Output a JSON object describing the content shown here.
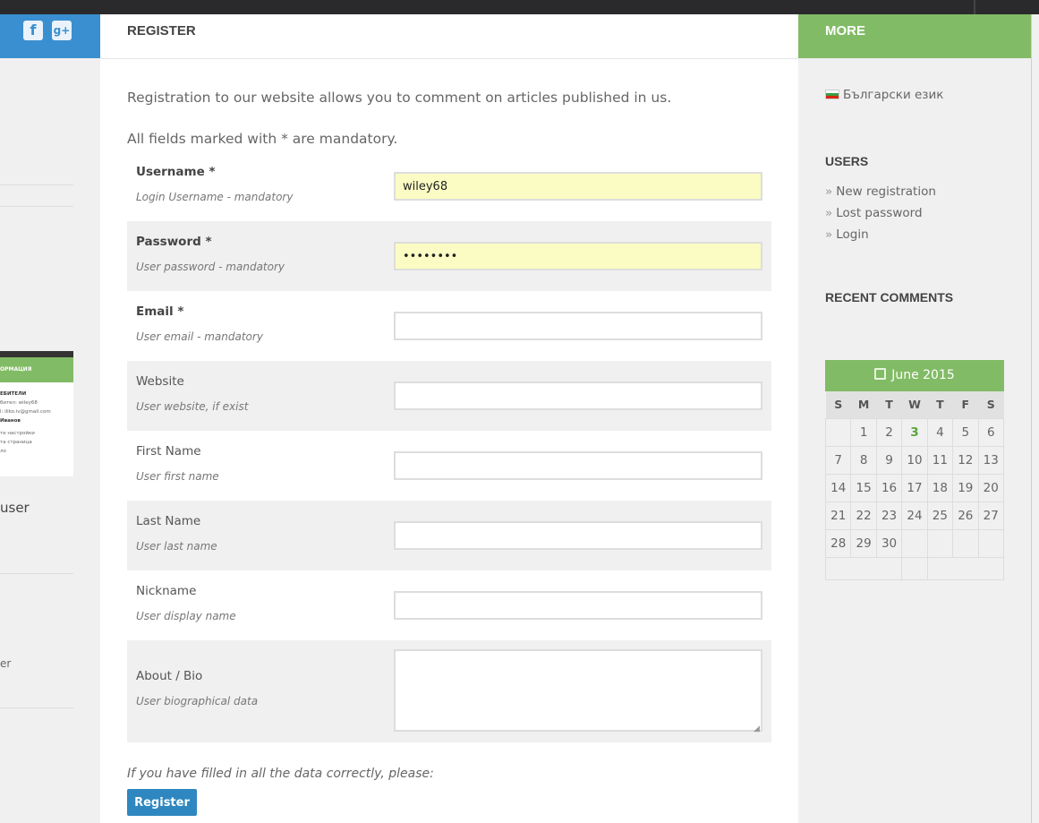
{
  "social": {
    "facebook_glyph": "f",
    "googleplus_glyph": "g+"
  },
  "left_preview": {
    "thumb_header": "ОРМАЦИЯ",
    "thumb_lines": [
      "ЕБИТЕЛИ",
      "бител: wiley68",
      "l: iliko.iv@gmail.com",
      "Иванов",
      "те настройки",
      "та страница",
      "ло"
    ],
    "user_text": "user",
    "er_text": "er"
  },
  "main": {
    "title": "REGISTER",
    "intro": "Registration to our website allows you to comment on articles published in us.",
    "mandatory_note": "All fields marked with * are mandatory.",
    "fields": [
      {
        "label": "Username *",
        "hint": "Login Username - mandatory",
        "value": "wiley68"
      },
      {
        "label": "Password *",
        "hint": "User password - mandatory",
        "value": "••••••••"
      },
      {
        "label": "Email *",
        "hint": "User email - mandatory",
        "value": ""
      },
      {
        "label": "Website",
        "hint": "User website, if exist",
        "value": ""
      },
      {
        "label": "First Name",
        "hint": "User first name",
        "value": ""
      },
      {
        "label": "Last Name",
        "hint": "User last name",
        "value": ""
      },
      {
        "label": "Nickname",
        "hint": "User display name",
        "value": ""
      },
      {
        "label": "About / Bio",
        "hint": "User biographical data",
        "value": ""
      }
    ],
    "submit_note": "If you have filled in all the data correctly, please:",
    "register_label": "Register"
  },
  "sidebar": {
    "title": "MORE",
    "language": "Български език",
    "users_heading": "USERS",
    "links": [
      "New registration",
      "Lost password",
      "Login"
    ],
    "link_arrow": "»",
    "recent_heading": "RECENT COMMENTS",
    "calendar": {
      "month": "June 2015",
      "weekdays": [
        "S",
        "M",
        "T",
        "W",
        "T",
        "F",
        "S"
      ],
      "weeks": [
        [
          "",
          "1",
          "2",
          "3",
          "4",
          "5",
          "6"
        ],
        [
          "7",
          "8",
          "9",
          "10",
          "11",
          "12",
          "13"
        ],
        [
          "14",
          "15",
          "16",
          "17",
          "18",
          "19",
          "20"
        ],
        [
          "21",
          "22",
          "23",
          "24",
          "25",
          "26",
          "27"
        ],
        [
          "28",
          "29",
          "30",
          "",
          "",
          "",
          ""
        ]
      ],
      "today": "3"
    }
  },
  "colors": {
    "accent_green": "#82bb66",
    "accent_blue": "#2e87c0",
    "autofill": "#fbfcc4"
  }
}
